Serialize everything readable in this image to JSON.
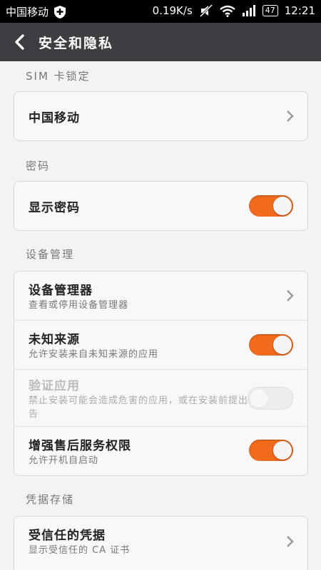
{
  "status_bar": {
    "carrier": "中国移动",
    "speed": "0.19K/s",
    "battery": "47",
    "time": "12:21"
  },
  "header": {
    "title": "安全和隐私"
  },
  "sections": {
    "sim": {
      "label": "SIM 卡锁定",
      "carrier_item": "中国移动"
    },
    "password": {
      "label": "密码",
      "show_password": "显示密码",
      "show_password_on": true
    },
    "device": {
      "label": "设备管理",
      "admins_title": "设备管理器",
      "admins_sub": "查看或停用设备管理器",
      "unknown_title": "未知来源",
      "unknown_sub": "允许安装来自未知来源的应用",
      "unknown_on": true,
      "verify_title": "验证应用",
      "verify_sub": "禁止安装可能会造成危害的应用，或在安装前提出警告",
      "verify_on": false,
      "after_sales_title": "增强售后服务权限",
      "after_sales_sub": "允许开机自启动",
      "after_sales_on": true
    },
    "credentials": {
      "label": "凭据存储",
      "trusted_title": "受信任的凭据",
      "trusted_sub": "显示受信任的 CA 证书"
    }
  },
  "colors": {
    "accent": "#f26b1d",
    "header_bg": "#3e3e42",
    "status_bg": "#000000"
  }
}
